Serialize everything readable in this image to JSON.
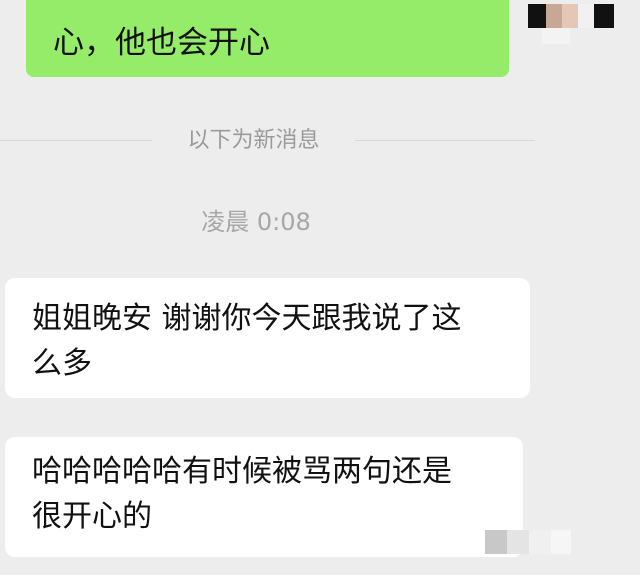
{
  "messages": {
    "sent": [
      {
        "text": "心，他也会开心"
      }
    ],
    "divider_label": "以下为新消息",
    "timestamp": "凌晨 0:08",
    "received": [
      {
        "line1": "姐姐晚安 谢谢你今天跟我说了这",
        "line2": "么多"
      },
      {
        "line1": "哈哈哈哈哈有时候被骂两句还是",
        "line2": "很开心的"
      }
    ]
  },
  "colors": {
    "background": "#ededed",
    "sent_bubble": "#95ec69",
    "received_bubble": "#ffffff",
    "meta_text": "#9a9a9a"
  },
  "icons": {
    "avatar": "pixelated-avatar",
    "watermark": "pixelated-watermark"
  }
}
